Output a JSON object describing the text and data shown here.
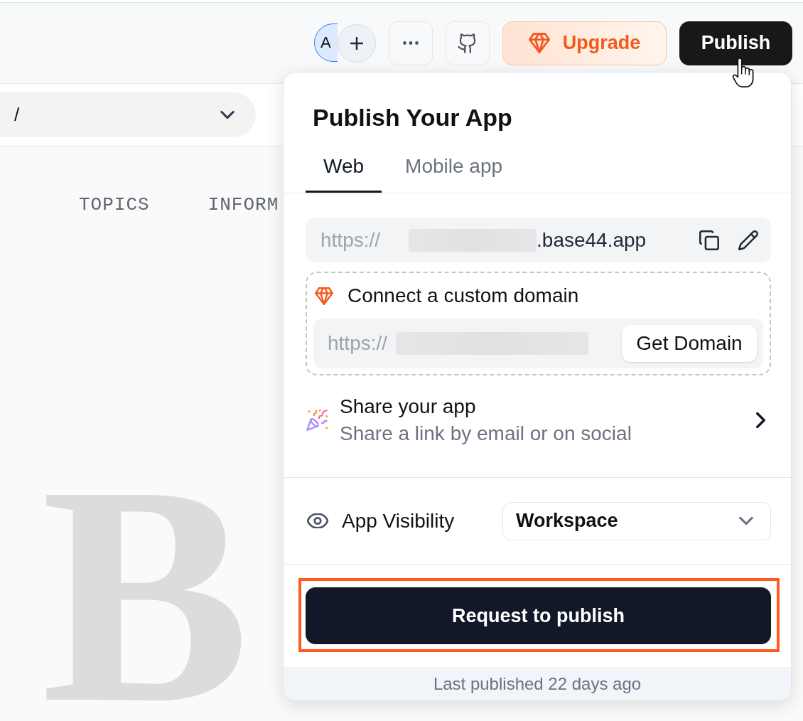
{
  "top_bar": {
    "avatar_initials": "A",
    "upgrade_button": "Upgrade",
    "publish_button": "Publish"
  },
  "page_selector": {
    "value": "/"
  },
  "page_nav": [
    "TOPICS",
    "INFORM"
  ],
  "hero_letter": "B",
  "publish_panel": {
    "title": "Publish Your App",
    "tabs": [
      {
        "label": "Web",
        "selected": true
      },
      {
        "label": "Mobile app",
        "selected": false
      }
    ],
    "app_url": {
      "prefix": "https://",
      "suffix": ".base44.app"
    },
    "custom_domain": {
      "title": "Connect a custom domain",
      "url_prefix": "https://",
      "button": "Get Domain"
    },
    "share": {
      "title": "Share your app",
      "subtitle": "Share a link by email or on social"
    },
    "visibility": {
      "label": "App Visibility",
      "value": "Workspace"
    },
    "primary_button": {
      "label": "Request to publish",
      "highlighted": true
    },
    "footer": "Last published 22 days ago"
  }
}
